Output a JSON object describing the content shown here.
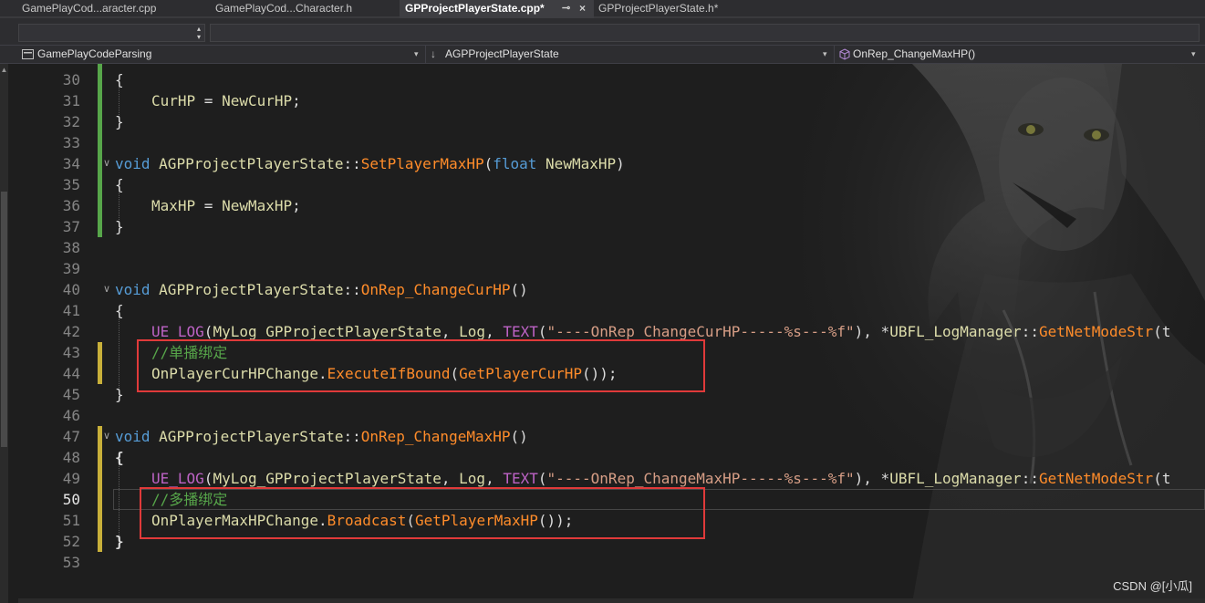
{
  "tabs": [
    {
      "label": "GamePlayCod...aracter.cpp",
      "active": false
    },
    {
      "label": "GamePlayCod...Character.h",
      "active": false
    },
    {
      "label": "GPProjectPlayerState.cpp*",
      "active": true
    },
    {
      "label": "GPProjectPlayerState.h*",
      "active": false
    }
  ],
  "nav": {
    "project": "GamePlayCodeParsing",
    "class": "AGPProjectPlayerState",
    "member": "OnRep_ChangeMaxHP()"
  },
  "line_numbers": [
    "30",
    "31",
    "32",
    "33",
    "34",
    "35",
    "36",
    "37",
    "38",
    "39",
    "40",
    "41",
    "42",
    "43",
    "44",
    "45",
    "46",
    "47",
    "48",
    "49",
    "50",
    "51",
    "52",
    "53"
  ],
  "current_line": "50",
  "code": {
    "l30": {
      "brace": "{"
    },
    "l31": {
      "lhs": "CurHP",
      "op": " = ",
      "rhs": "NewCurHP",
      "end": ";"
    },
    "l32": {
      "brace": "}"
    },
    "l34": {
      "void": "void",
      "cls": "AGPProjectPlayerState",
      "sep": "::",
      "fn": "SetPlayerMaxHP",
      "open": "(",
      "float": "float",
      "param": "NewMaxHP",
      "close": ")"
    },
    "l35": {
      "brace": "{"
    },
    "l36": {
      "lhs": "MaxHP",
      "op": " = ",
      "rhs": "NewMaxHP",
      "end": ";"
    },
    "l37": {
      "brace": "}"
    },
    "l40": {
      "void": "void",
      "cls": "AGPProjectPlayerState",
      "sep": "::",
      "fn": "OnRep_ChangeCurHP",
      "parens": "()"
    },
    "l41": {
      "brace": "{"
    },
    "l42": {
      "macro": "UE_LOG",
      "open": "(",
      "a1": "MyLog_GPProjectPlayerState",
      "c1": ", ",
      "a2": "Log",
      "c2": ", ",
      "text": "TEXT",
      "open2": "(",
      "str": "\"----OnRep_ChangeCurHP-----%s---%f\"",
      "c3": "), *",
      "cls": "UBFL_LogManager",
      "sep": "::",
      "fn": "GetNetModeStr",
      "tail": "(t"
    },
    "l43": {
      "comment": "//单播绑定"
    },
    "l44": {
      "obj": "OnPlayerCurHPChange",
      "dot": ".",
      "fn": "ExecuteIfBound",
      "open": "(",
      "arg": "GetPlayerCurHP",
      "close": "());"
    },
    "l45": {
      "brace": "}"
    },
    "l47": {
      "void": "void",
      "cls": "AGPProjectPlayerState",
      "sep": "::",
      "fn": "OnRep_ChangeMaxHP",
      "parens": "()"
    },
    "l48": {
      "brace": "{"
    },
    "l49": {
      "macro": "UE_LOG",
      "open": "(",
      "a1": "MyLog_GPProjectPlayerState",
      "c1": ", ",
      "a2": "Log",
      "c2": ", ",
      "text": "TEXT",
      "open2": "(",
      "str": "\"----OnRep_ChangeMaxHP-----%s---%f\"",
      "c3": "), *",
      "cls": "UBFL_LogManager",
      "sep": "::",
      "fn": "GetNetModeStr",
      "tail": "(t"
    },
    "l50": {
      "comment": "//多播绑定"
    },
    "l51": {
      "obj": "OnPlayerMaxHPChange",
      "dot": ".",
      "fn": "Broadcast",
      "open": "(",
      "arg": "GetPlayerMaxHP",
      "close": "());"
    },
    "l52": {
      "brace": "}"
    }
  },
  "watermark": "CSDN @[小瓜]",
  "icons": {
    "class_icon": "class-arrow-icon",
    "member_icon": "method-cube-icon",
    "project_icon": "project-icon"
  },
  "colors": {
    "keyword": "#569cd6",
    "function": "#ff8c2a",
    "comment": "#57a64a",
    "string": "#d69d85",
    "macro": "#bd63c5",
    "highlight_box": "#e03a3a",
    "change_saved": "#57a64a",
    "change_unsaved": "#c8b03a"
  }
}
